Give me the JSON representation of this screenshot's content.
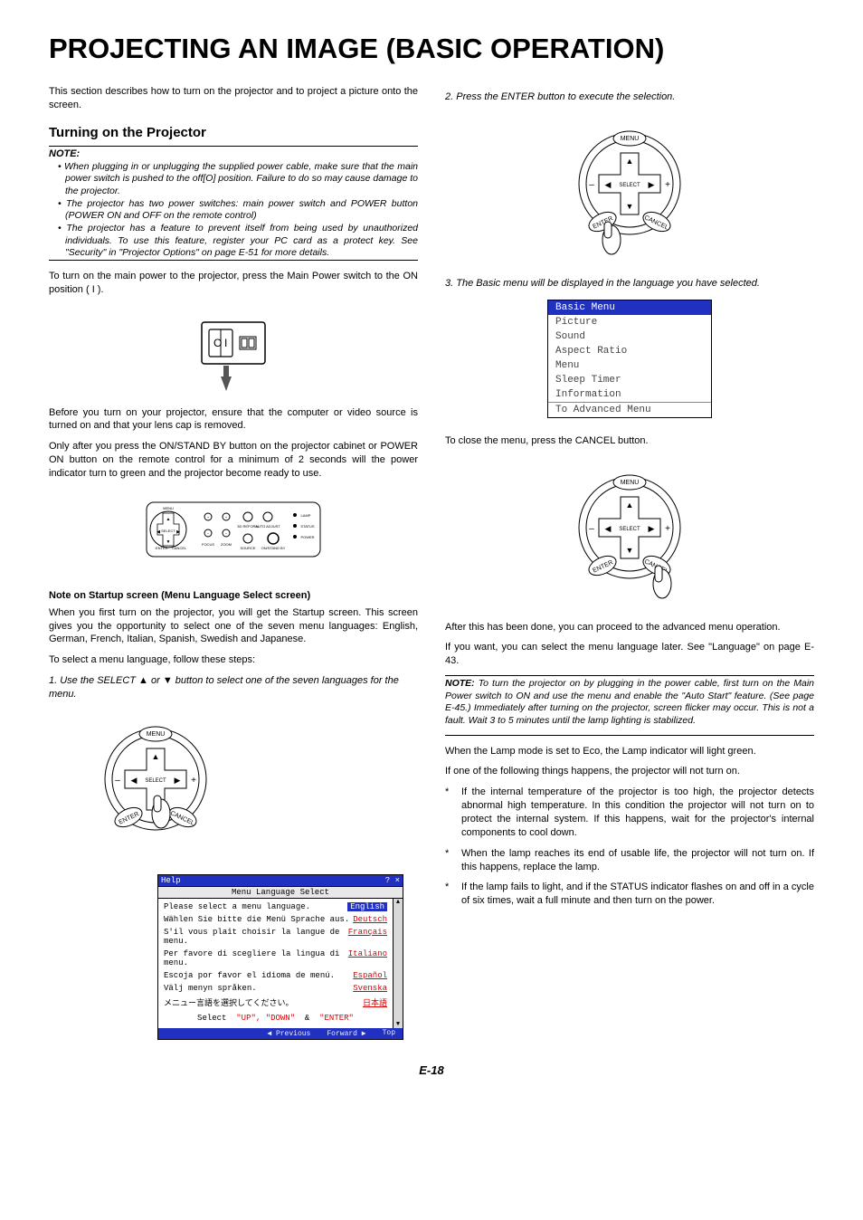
{
  "title": "PROJECTING AN IMAGE (BASIC OPERATION)",
  "intro": "This section describes how to turn on the projector and to project a picture onto the screen.",
  "section1_heading": "Turning on the Projector",
  "note_label": "NOTE:",
  "notes": [
    "When plugging in or unplugging the supplied power cable, make sure that the main power switch is pushed to the off[O] position. Failure to do so may cause damage to the projector.",
    "The projector has two power switches: main power switch and POWER button (POWER ON and OFF on the remote control)",
    "The projector has a feature to prevent itself from being used by unauthorized individuals. To use this feature, register your PC card as a protect key. See \"Security\" in \"Projector Options\" on page E-51 for more details."
  ],
  "p_mainpower": "To turn on the main power to the projector, press the Main Power switch to the ON position ( I ).",
  "p_before": "Before you turn on your projector, ensure that the computer or video source is turned on and that your lens cap is removed.",
  "p_onlyafter": "Only after you press the ON/STAND BY button on the projector cabinet or POWER ON button on the remote control for a minimum of 2 seconds will the power indicator turn to green and the projector become ready to use.",
  "h3_startup": "Note on Startup screen (Menu Language Select screen)",
  "p_startup1": "When you first turn on the projector, you will get the Startup screen. This screen gives you the opportunity to select one of the seven menu languages: English, German, French, Italian, Spanish, Swedish and Japanese.",
  "p_startup2": "To select a menu language, follow these steps:",
  "step1": "1. Use the SELECT ▲ or ▼ button to select one of the seven languages for the menu.",
  "remote": {
    "menu": "MENU",
    "select": "SELECT",
    "enter": "ENTER",
    "cancel": "CANCEL",
    "minus": "–",
    "plus": "+"
  },
  "lang_dialog": {
    "titlebar": "Help",
    "wincontrols": "? ×",
    "subheader": "Menu Language Select",
    "rows": [
      {
        "prompt": "Please select a menu language.",
        "lang": "English",
        "selected": true
      },
      {
        "prompt": "Wählen Sie bitte die Menü Sprache aus.",
        "lang": "Deutsch",
        "selected": false
      },
      {
        "prompt": "S'il vous plaît choisir la langue de menu.",
        "lang": "Français",
        "selected": false
      },
      {
        "prompt": "Per favore di scegliere la lingua di menu.",
        "lang": "Italiano",
        "selected": false
      },
      {
        "prompt": "Escoja por favor el idioma de menú.",
        "lang": "Español",
        "selected": false
      },
      {
        "prompt": "Välj menyn språken.",
        "lang": "Svenska",
        "selected": false
      },
      {
        "prompt": "メニュー言語を選択してください。",
        "lang": "日本語",
        "selected": false
      }
    ],
    "instr_label": "Select",
    "instr_up": "\"UP\"",
    "instr_down": "\"DOWN\"",
    "instr_amp": "&",
    "instr_enter": "\"ENTER\"",
    "footer_prev": "◀ Previous",
    "footer_fwd": "Forward ▶",
    "footer_top": "Top"
  },
  "step2": "2. Press the ENTER button to execute the selection.",
  "step3": "3. The Basic menu will be displayed in the language you have selected.",
  "basic_menu": {
    "title": "Basic Menu",
    "items": [
      "Picture",
      "Sound",
      "Aspect Ratio",
      "Menu",
      "Sleep Timer",
      "Information"
    ],
    "adv": "To Advanced Menu"
  },
  "p_close": "To close the menu, press the CANCEL button.",
  "p_afterdone": "After this has been done, you can proceed to the advanced menu operation.",
  "p_ifwant": "If you want, you can select the menu language later. See \"Language\" on page E-43.",
  "note2_label": "NOTE:",
  "note2_body": " To turn the projector on by plugging in the power cable, first turn on the Main Power switch to ON and use the menu and enable the \"Auto Start\" feature. (See page E-45.) Immediately after turning on the projector, screen flicker may occur. This is not a fault. Wait 3 to 5 minutes until the lamp lighting is stabilized.",
  "p_lampeco": "When the Lamp mode is set to Eco, the Lamp indicator will light green.",
  "p_ifone": "If one of the following things happens, the projector will not turn on.",
  "starlist": [
    "If the internal temperature of the projector is too high, the projector detects abnormal high temperature. In this condition the projector will not turn on to protect the internal system. If this happens, wait for the projector's internal components to cool down.",
    "When the lamp reaches its end of usable life, the projector will not turn on. If this happens, replace the lamp.",
    "If the lamp fails to light, and if the STATUS indicator flashes on and off in a cycle of six times, wait a full minute and then turn on the power."
  ],
  "page_num": "E-18",
  "switch_labels": {
    "o": "O",
    "i": "I"
  },
  "panel_labels": {
    "select": "SELECT",
    "focus": "FOCUS",
    "zoom": "ZOOM",
    "pcadj": "3D REFORM",
    "auto": "AUTO ADJUST",
    "source": "SOURCE",
    "onstandby": "ON/ STAND BY",
    "lamp": "LAMP",
    "status": "STATUS",
    "power": "POWER"
  }
}
